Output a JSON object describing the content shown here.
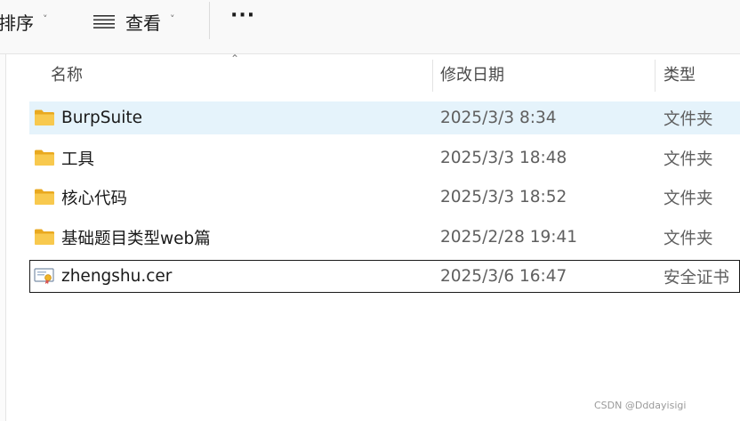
{
  "toolbar": {
    "sort_label": "排序",
    "view_label": "查看",
    "chevron": "˅",
    "more": "···"
  },
  "columns": {
    "name": "名称",
    "modified": "修改日期",
    "type": "类型"
  },
  "files": [
    {
      "name": "BurpSuite",
      "date": "2025/3/3 8:34",
      "type": "文件夹",
      "icon": "folder-icon"
    },
    {
      "name": "工具",
      "date": "2025/3/3 18:48",
      "type": "文件夹",
      "icon": "folder-icon"
    },
    {
      "name": "核心代码",
      "date": "2025/3/3 18:52",
      "type": "文件夹",
      "icon": "folder-icon"
    },
    {
      "name": "基础题目类型web篇",
      "date": "2025/2/28 19:41",
      "type": "文件夹",
      "icon": "folder-icon"
    },
    {
      "name": "zhengshu.cer",
      "date": "2025/3/6 16:47",
      "type": "安全证书",
      "icon": "certificate-icon"
    }
  ],
  "watermark": "CSDN @Dddayisigi",
  "colors": {
    "hover_row": "#e5f3fb",
    "folder": "#f8c94e",
    "toolbar_bg": "#f9f9f9"
  }
}
